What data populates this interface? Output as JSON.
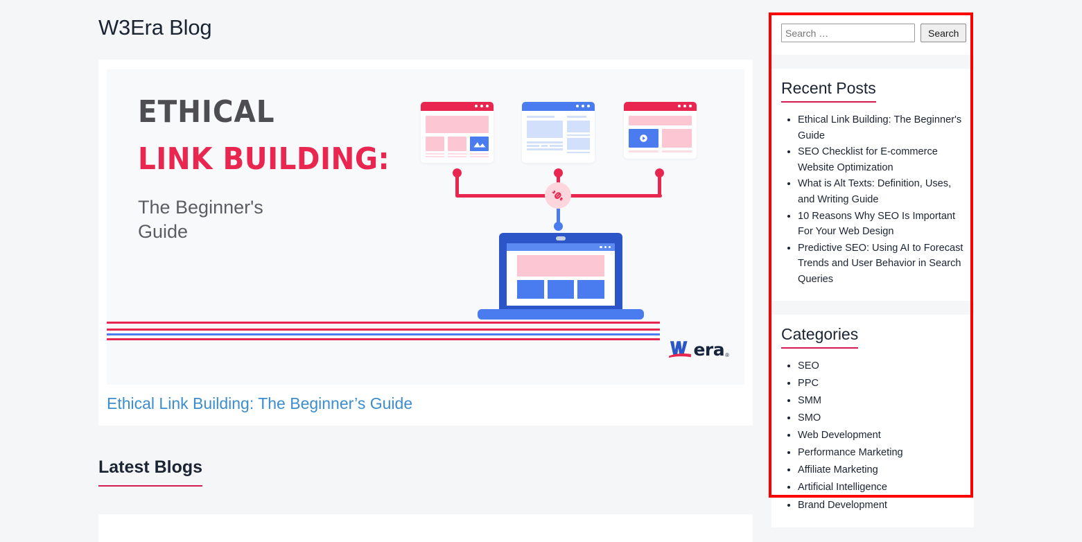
{
  "page": {
    "title": "W3Era Blog",
    "background_color": "#f5f6f7",
    "annotation_color": "#fc0000"
  },
  "featured_post": {
    "image": {
      "headline_line1": "ETHICAL",
      "headline_line2": "LINK BUILDING:",
      "subhead_line1": "The Beginner's",
      "subhead_line2": "Guide",
      "headline1_color": "#4d4d52",
      "headline2_color": "#e8264f",
      "logo_text": "era",
      "logo_mark": "w3",
      "logo_registered": "®",
      "illustration": "three-browser-windows-linked-to-laptop"
    },
    "title_link": "Ethical Link Building: The Beginner’s Guide",
    "title_link_color": "#3c8dcd"
  },
  "latest_blogs": {
    "heading": "Latest Blogs",
    "underline_color": "#d31b52"
  },
  "sidebar": {
    "search": {
      "placeholder": "Search …",
      "value": "",
      "button_label": "Search"
    },
    "recent_posts": {
      "heading": "Recent Posts",
      "items": [
        "Ethical Link Building: The Beginner's Guide",
        "SEO Checklist for E-commerce Website Optimization",
        "What is Alt Texts: Definition, Uses, and Writing Guide",
        "10 Reasons Why SEO Is Important For Your Web Design",
        "Predictive SEO: Using AI to Forecast Trends and User Behavior in Search Queries"
      ]
    },
    "categories": {
      "heading": "Categories",
      "items": [
        "SEO",
        "PPC",
        "SMM",
        "SMO",
        "Web Development",
        "Performance Marketing",
        "Affiliate Marketing",
        "Artificial Intelligence",
        "Brand Development"
      ]
    }
  }
}
